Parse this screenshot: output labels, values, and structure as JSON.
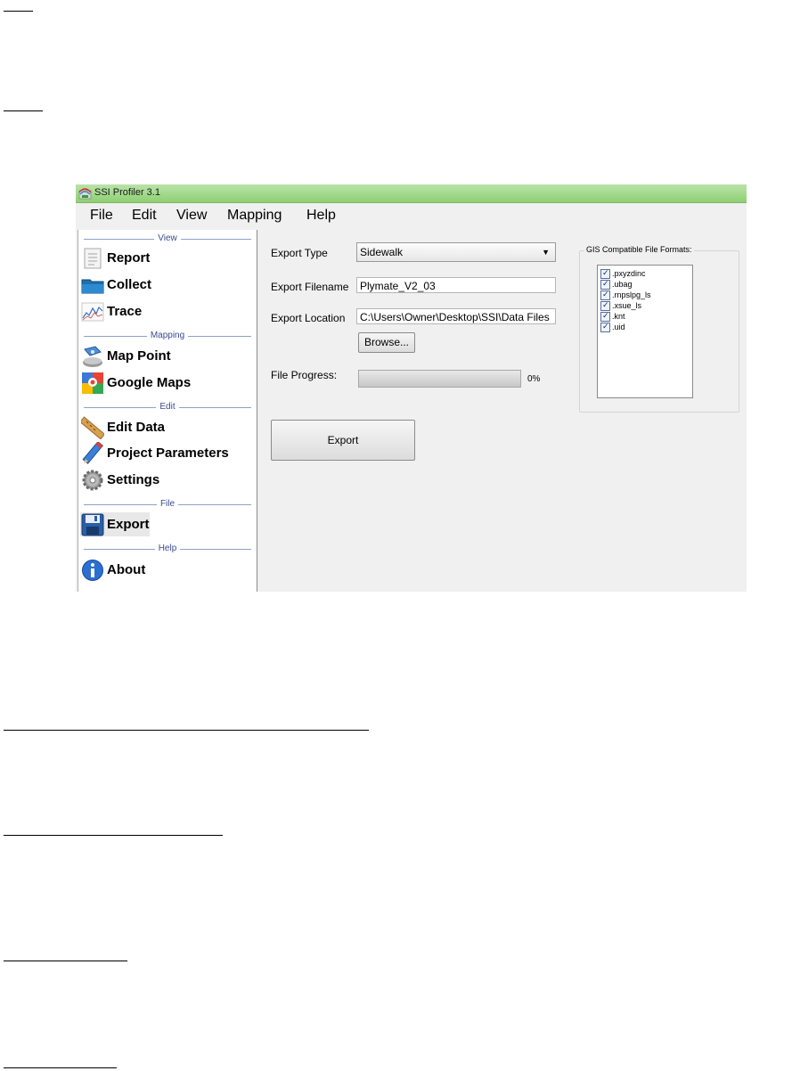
{
  "window": {
    "title": "SSI Profiler 3.1",
    "menu": [
      "File",
      "Edit",
      "View",
      "Mapping",
      "Help"
    ]
  },
  "sidebar": {
    "sections": {
      "view": "View",
      "mapping": "Mapping",
      "edit": "Edit",
      "file": "File",
      "help": "Help"
    },
    "items": {
      "report": "Report",
      "collect": "Collect",
      "trace": "Trace",
      "map_point": "Map Point",
      "google_maps": "Google Maps",
      "edit_data": "Edit Data",
      "project_parameters": "Project Parameters",
      "settings": "Settings",
      "export": "Export",
      "about": "About"
    },
    "selected": "Export"
  },
  "export_form": {
    "type_label": "Export Type",
    "type_value": "Sidewalk",
    "filename_label": "Export Filename",
    "filename_value": "Plymate_V2_03",
    "location_label": "Export Location",
    "location_value": "C:\\Users\\Owner\\Desktop\\SSI\\Data Files",
    "browse_label": "Browse...",
    "progress_label": "File Progress:",
    "progress_percent_text": "0%",
    "progress_value": 0,
    "export_button_label": "Export"
  },
  "gis_formats": {
    "title": "GIS Compatible File Formats:",
    "items": [
      {
        "label": ".pxyzdinc",
        "checked": true
      },
      {
        "label": ".ubag",
        "checked": true
      },
      {
        "label": ".rnpslpg_ls",
        "checked": true
      },
      {
        "label": ".xsue_ls",
        "checked": true
      },
      {
        "label": ".knt",
        "checked": true
      },
      {
        "label": ".uid",
        "checked": true
      }
    ]
  },
  "colors": {
    "titlebar": "#9fd888",
    "window_bg": "#f0f0f0",
    "section_line": "#8ea0c8"
  },
  "icons": [
    "report-icon",
    "collect-icon",
    "trace-icon",
    "map-point-icon",
    "google-maps-icon",
    "edit-data-icon",
    "project-parameters-icon",
    "settings-icon",
    "export-icon",
    "about-icon"
  ]
}
